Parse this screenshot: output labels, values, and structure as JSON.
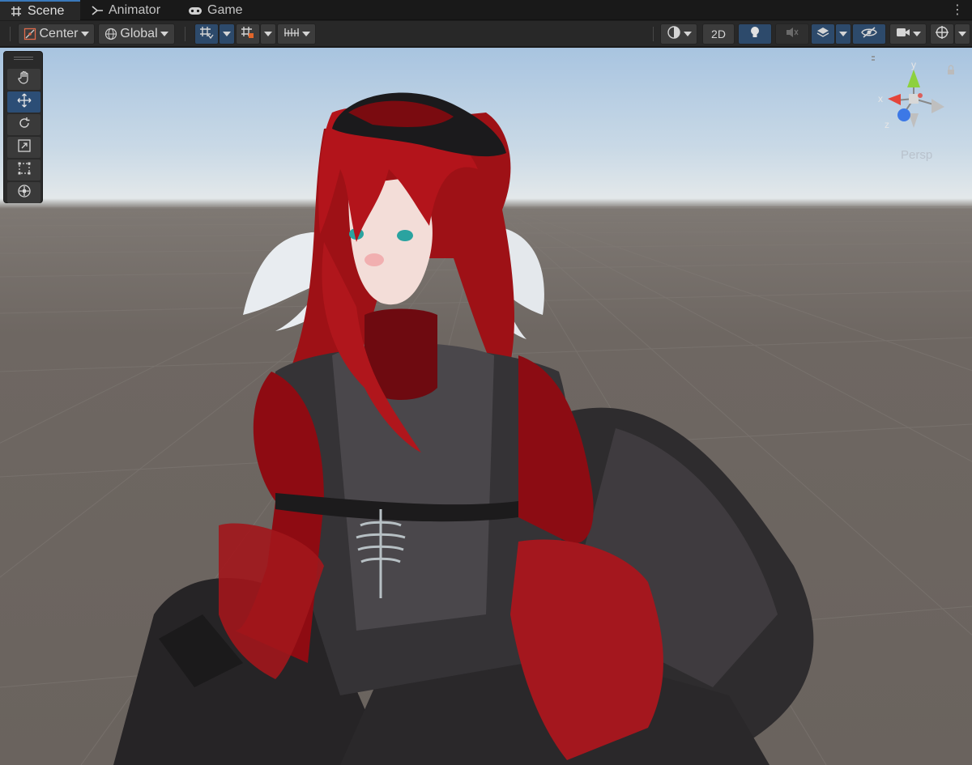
{
  "tabs": [
    {
      "label": "Scene",
      "icon": "grid-hash-icon",
      "active": true
    },
    {
      "label": "Animator",
      "icon": "animator-icon",
      "active": false
    },
    {
      "label": "Game",
      "icon": "gamepad-icon",
      "active": false
    }
  ],
  "toolbar": {
    "pivot_label": "Center",
    "space_label": "Global",
    "toggle_2d_label": "2D"
  },
  "viewport": {
    "projection_label": "Persp",
    "gizmo_axes": {
      "x": "x",
      "y": "y",
      "z": "z"
    }
  },
  "colors": {
    "accent_blue": "#2d4a6b",
    "tool_active": "#2c4e76",
    "axis_x": "#e4453a",
    "axis_y": "#8dd13e",
    "axis_z": "#3c78e6",
    "sky_top": "#a8c4e0",
    "ground": "#6e6762"
  }
}
